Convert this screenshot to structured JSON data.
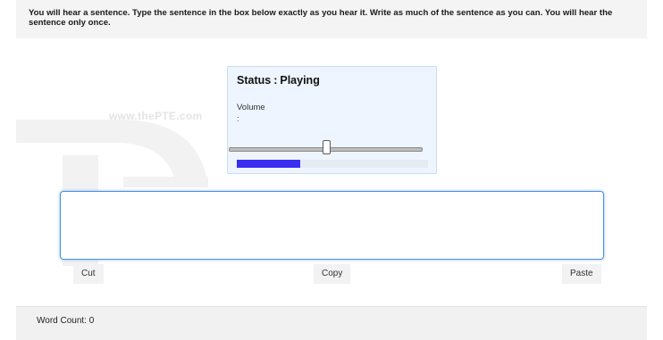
{
  "instructions": "You will hear a sentence. Type the sentence in the box below exactly as you hear it. Write as much of the sentence as you can. You will hear the sentence only once.",
  "watermark": "www.thePTE.com",
  "player": {
    "status_label": "Status",
    "status_value": "Playing",
    "volume_label": "Volume",
    "volume_colon": ":",
    "volume_level": 0.51,
    "playback_progress": 0.33,
    "progress_color": "#3a2ff0"
  },
  "answer": {
    "value": "",
    "placeholder": ""
  },
  "buttons": {
    "cut": "Cut",
    "copy": "Copy",
    "paste": "Paste"
  },
  "footer": {
    "word_count_label": "Word Count",
    "word_count_value": "0"
  }
}
